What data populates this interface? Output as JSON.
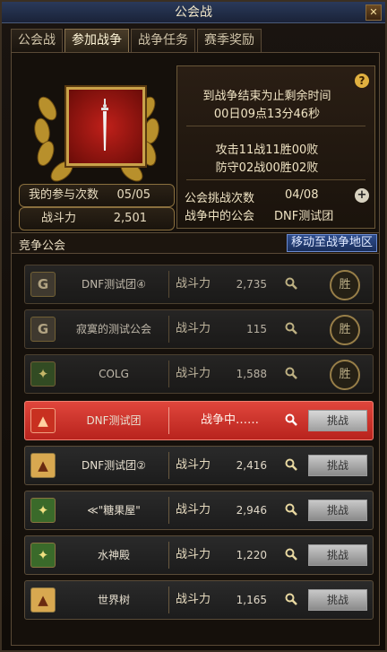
{
  "window": {
    "title": "公会战"
  },
  "tabs": [
    {
      "label": "公会战",
      "active": false
    },
    {
      "label": "参加战争",
      "active": true
    },
    {
      "label": "战争任务",
      "active": false
    },
    {
      "label": "赛季奖励",
      "active": false
    }
  ],
  "my_stats": {
    "participation_label": "我的参与次数",
    "participation_value": "05/05",
    "power_label": "战斗力",
    "power_value": "2,501"
  },
  "info": {
    "remaining_label": "到战争结束为止剩余时间",
    "remaining_time": "00日09点13分46秒",
    "attack_record": "攻击11战11胜00败",
    "defense_record": "防守02战00胜02败",
    "challenge_count_label": "公会挑战次数",
    "challenge_count_value": "04/08",
    "warring_guild_label": "战争中的公会",
    "warring_guild_value": "DNF测试团"
  },
  "section": {
    "title": "竞争公会",
    "move_button": "移动至战争地区"
  },
  "guilds": [
    {
      "badge": "G",
      "name": "DNF测试团④",
      "power_label": "战斗力",
      "power": "2,735",
      "action": "胜",
      "state": "won"
    },
    {
      "badge": "G",
      "name": "寂寞的测试公会",
      "power_label": "战斗力",
      "power": "115",
      "action": "胜",
      "state": "won"
    },
    {
      "badge": "✦",
      "name": "COLG",
      "power_label": "战斗力",
      "power": "1,588",
      "action": "胜",
      "state": "won"
    },
    {
      "badge": "▲",
      "name": "DNF测试团",
      "status_text": "战争中……",
      "action": "挑战",
      "state": "active"
    },
    {
      "badge": "▲",
      "name": "DNF测试团②",
      "power_label": "战斗力",
      "power": "2,416",
      "action": "挑战",
      "state": "open"
    },
    {
      "badge": "✦",
      "name": "≪\"糖果屋\"",
      "power_label": "战斗力",
      "power": "2,946",
      "action": "挑战",
      "state": "open"
    },
    {
      "badge": "✦",
      "name": "水神殿",
      "power_label": "战斗力",
      "power": "1,220",
      "action": "挑战",
      "state": "open"
    },
    {
      "badge": "▲",
      "name": "世界树",
      "power_label": "战斗力",
      "power": "1,165",
      "action": "挑战",
      "state": "open"
    }
  ],
  "colors": {
    "accent_gold": "#c9a24a",
    "active_row": "#d0392f",
    "panel_bg": "#15100b"
  }
}
